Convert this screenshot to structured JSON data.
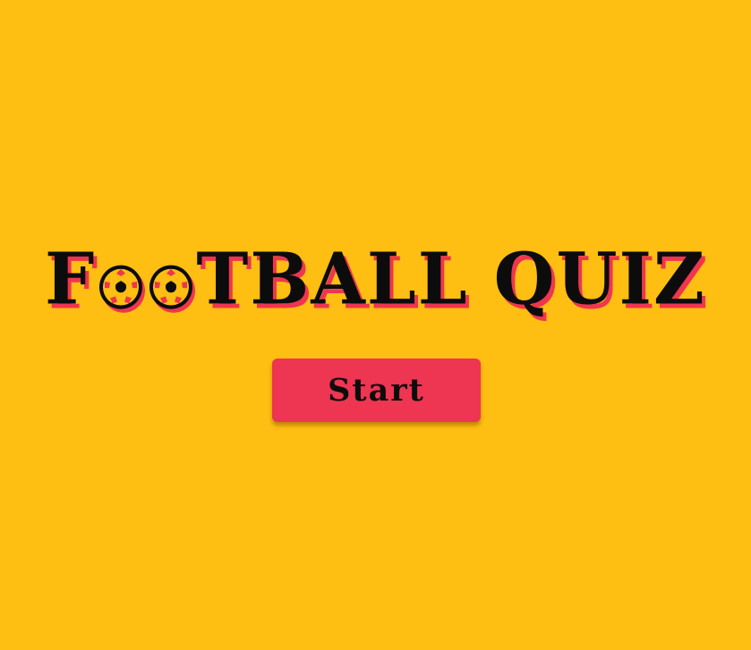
{
  "title": {
    "part1": "F",
    "ball_icons": [
      "soccer-ball-icon",
      "soccer-ball-icon"
    ],
    "part2": "TBALL",
    "part3": "QUIZ"
  },
  "start_button": {
    "label": "Start"
  },
  "colors": {
    "background": "#FFBE12",
    "accent": "#EE3552",
    "text": "#0c0c0c"
  }
}
